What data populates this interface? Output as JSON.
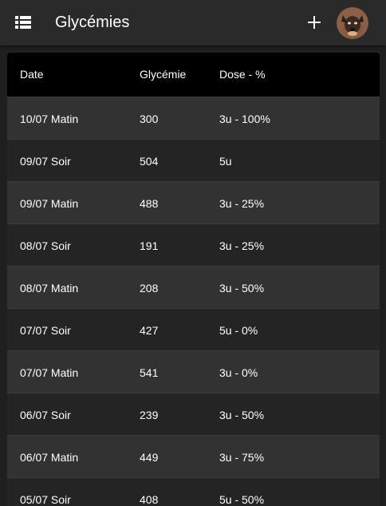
{
  "appbar": {
    "title": "Glycémies",
    "menu_icon": "list-menu-icon",
    "add_icon": "plus-icon",
    "avatar_icon": "user-avatar"
  },
  "table": {
    "headers": {
      "date": "Date",
      "glycemie": "Glycémie",
      "dose": "Dose - %"
    },
    "rows": [
      {
        "date": "10/07 Matin",
        "glycemie": "300",
        "dose": "3u - 100%"
      },
      {
        "date": "09/07 Soir",
        "glycemie": "504",
        "dose": "5u"
      },
      {
        "date": "09/07 Matin",
        "glycemie": "488",
        "dose": "3u - 25%"
      },
      {
        "date": "08/07 Soir",
        "glycemie": "191",
        "dose": "3u - 25%"
      },
      {
        "date": "08/07 Matin",
        "glycemie": "208",
        "dose": "3u - 50%"
      },
      {
        "date": "07/07 Soir",
        "glycemie": "427",
        "dose": "5u - 0%"
      },
      {
        "date": "07/07 Matin",
        "glycemie": "541",
        "dose": "3u - 0%"
      },
      {
        "date": "06/07 Soir",
        "glycemie": "239",
        "dose": "3u - 50%"
      },
      {
        "date": "06/07 Matin",
        "glycemie": "449",
        "dose": "3u - 75%"
      },
      {
        "date": "05/07 Soir",
        "glycemie": "408",
        "dose": "5u - 50%"
      }
    ]
  },
  "colors": {
    "appbar_bg": "#2a2a2a",
    "header_bg": "#000000",
    "row_alt_bg": "#323232",
    "row_bg": "#242424",
    "text": "#ffffff"
  }
}
